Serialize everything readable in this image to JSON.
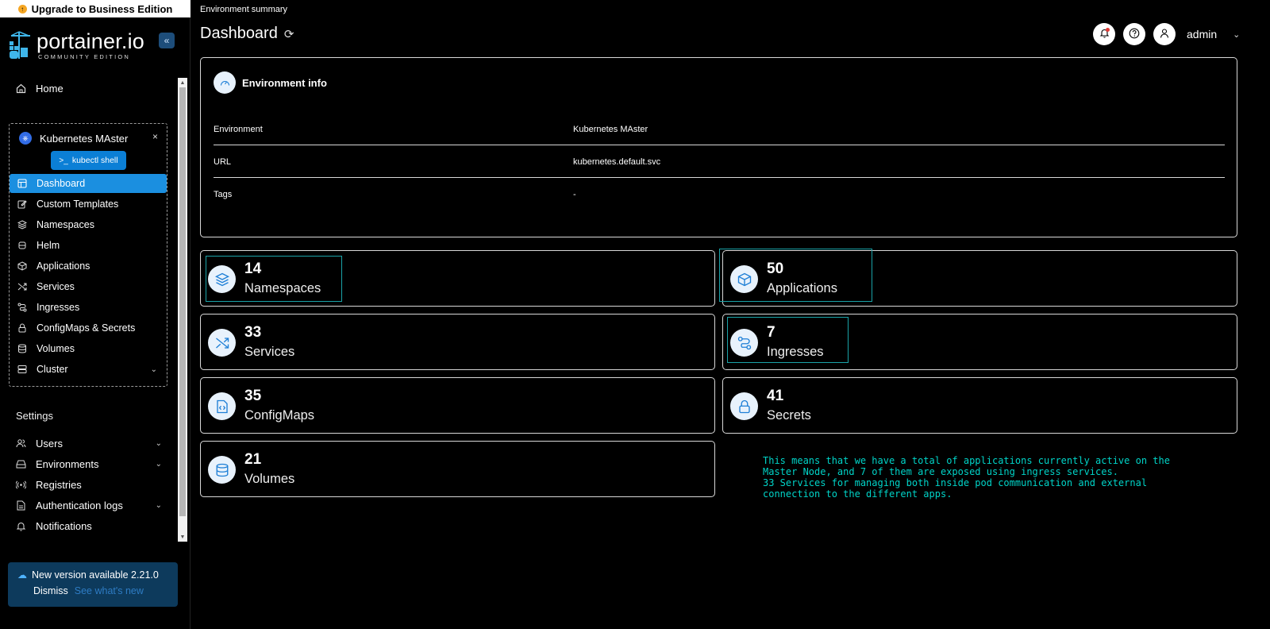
{
  "upgrade_banner": {
    "label": "Upgrade to Business Edition"
  },
  "logo": {
    "main": "portainer.io",
    "sub": "COMMUNITY EDITION"
  },
  "sidebar": {
    "home": "Home",
    "environment": {
      "name": "Kubernetes MAster",
      "close": "×",
      "kubectl_label": "kubectl shell",
      "items": [
        {
          "label": "Dashboard",
          "active": true
        },
        {
          "label": "Custom Templates"
        },
        {
          "label": "Namespaces"
        },
        {
          "label": "Helm"
        },
        {
          "label": "Applications"
        },
        {
          "label": "Services"
        },
        {
          "label": "Ingresses"
        },
        {
          "label": "ConfigMaps & Secrets"
        },
        {
          "label": "Volumes"
        },
        {
          "label": "Cluster"
        }
      ]
    },
    "settings_label": "Settings",
    "settings_items": [
      {
        "label": "Users"
      },
      {
        "label": "Environments"
      },
      {
        "label": "Registries"
      },
      {
        "label": "Authentication logs"
      },
      {
        "label": "Notifications"
      }
    ],
    "new_version": {
      "text": "New version available 2.21.0",
      "dismiss": "Dismiss",
      "link": "See what's new"
    }
  },
  "header": {
    "breadcrumb": "Environment summary",
    "title": "Dashboard",
    "user": "admin"
  },
  "env_info": {
    "title": "Environment info",
    "rows": [
      {
        "key": "Environment",
        "value": "Kubernetes MAster"
      },
      {
        "key": "URL",
        "value": "kubernetes.default.svc"
      },
      {
        "key": "Tags",
        "value": "-"
      }
    ]
  },
  "stats": {
    "namespaces": {
      "count": "14",
      "label": "Namespaces"
    },
    "applications": {
      "count": "50",
      "label": "Applications"
    },
    "services": {
      "count": "33",
      "label": "Services"
    },
    "ingresses": {
      "count": "7",
      "label": "Ingresses"
    },
    "configmaps": {
      "count": "35",
      "label": "ConfigMaps"
    },
    "secrets": {
      "count": "41",
      "label": "Secrets"
    },
    "volumes": {
      "count": "21",
      "label": "Volumes"
    }
  },
  "annotation": {
    "text": "This means that we have a total of applications currently active on the\nMaster Node, and 7 of them are exposed using ingress services.\n33 Services for managing both inside pod communication and external\nconnection to the different apps."
  },
  "colors": {
    "accent": "#1b8fe0",
    "highlight": "#1aa3a8",
    "note": "#00d4c8"
  }
}
